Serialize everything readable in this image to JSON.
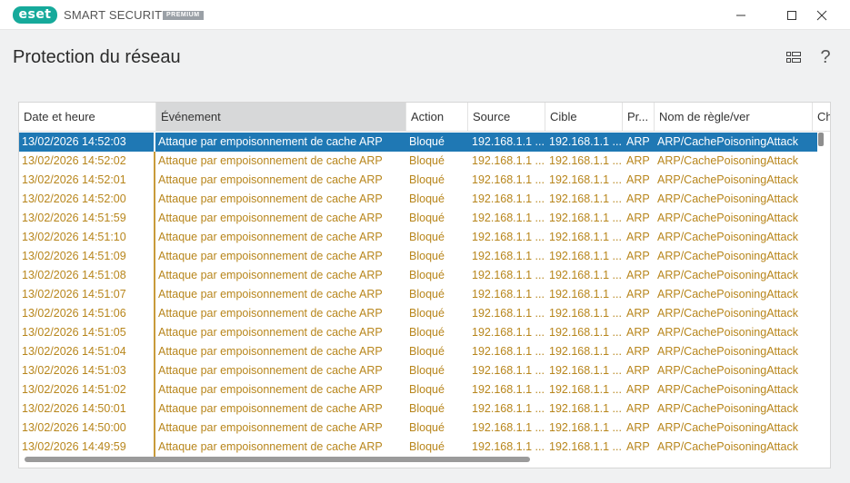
{
  "app": {
    "logo_text": "eset",
    "product_name": "SMART SECURITY",
    "edition": "PREMIUM"
  },
  "header": {
    "title": "Protection du réseau",
    "help_label": "?"
  },
  "table": {
    "columns": [
      "Date et heure",
      "Événement",
      "Action",
      "Source",
      "Cible",
      "Pr...",
      "Nom de règle/ver",
      "Ch"
    ],
    "sorted_column": "Événement",
    "rows": [
      {
        "date": "13/02/2026 14:52:03",
        "event": "Attaque par empoisonnement de cache ARP",
        "action": "Bloqué",
        "source": "192.168.1.1 ...",
        "target": "192.168.1.1 ...",
        "protocol": "ARP",
        "rule": "ARP/CachePoisoningAttack"
      },
      {
        "date": "13/02/2026 14:52:02",
        "event": "Attaque par empoisonnement de cache ARP",
        "action": "Bloqué",
        "source": "192.168.1.1 ...",
        "target": "192.168.1.1 ...",
        "protocol": "ARP",
        "rule": "ARP/CachePoisoningAttack"
      },
      {
        "date": "13/02/2026 14:52:01",
        "event": "Attaque par empoisonnement de cache ARP",
        "action": "Bloqué",
        "source": "192.168.1.1 ...",
        "target": "192.168.1.1 ...",
        "protocol": "ARP",
        "rule": "ARP/CachePoisoningAttack"
      },
      {
        "date": "13/02/2026 14:52:00",
        "event": "Attaque par empoisonnement de cache ARP",
        "action": "Bloqué",
        "source": "192.168.1.1 ...",
        "target": "192.168.1.1 ...",
        "protocol": "ARP",
        "rule": "ARP/CachePoisoningAttack"
      },
      {
        "date": "13/02/2026 14:51:59",
        "event": "Attaque par empoisonnement de cache ARP",
        "action": "Bloqué",
        "source": "192.168.1.1 ...",
        "target": "192.168.1.1 ...",
        "protocol": "ARP",
        "rule": "ARP/CachePoisoningAttack"
      },
      {
        "date": "13/02/2026 14:51:10",
        "event": "Attaque par empoisonnement de cache ARP",
        "action": "Bloqué",
        "source": "192.168.1.1 ...",
        "target": "192.168.1.1 ...",
        "protocol": "ARP",
        "rule": "ARP/CachePoisoningAttack"
      },
      {
        "date": "13/02/2026 14:51:09",
        "event": "Attaque par empoisonnement de cache ARP",
        "action": "Bloqué",
        "source": "192.168.1.1 ...",
        "target": "192.168.1.1 ...",
        "protocol": "ARP",
        "rule": "ARP/CachePoisoningAttack"
      },
      {
        "date": "13/02/2026 14:51:08",
        "event": "Attaque par empoisonnement de cache ARP",
        "action": "Bloqué",
        "source": "192.168.1.1 ...",
        "target": "192.168.1.1 ...",
        "protocol": "ARP",
        "rule": "ARP/CachePoisoningAttack"
      },
      {
        "date": "13/02/2026 14:51:07",
        "event": "Attaque par empoisonnement de cache ARP",
        "action": "Bloqué",
        "source": "192.168.1.1 ...",
        "target": "192.168.1.1 ...",
        "protocol": "ARP",
        "rule": "ARP/CachePoisoningAttack"
      },
      {
        "date": "13/02/2026 14:51:06",
        "event": "Attaque par empoisonnement de cache ARP",
        "action": "Bloqué",
        "source": "192.168.1.1 ...",
        "target": "192.168.1.1 ...",
        "protocol": "ARP",
        "rule": "ARP/CachePoisoningAttack"
      },
      {
        "date": "13/02/2026 14:51:05",
        "event": "Attaque par empoisonnement de cache ARP",
        "action": "Bloqué",
        "source": "192.168.1.1 ...",
        "target": "192.168.1.1 ...",
        "protocol": "ARP",
        "rule": "ARP/CachePoisoningAttack"
      },
      {
        "date": "13/02/2026 14:51:04",
        "event": "Attaque par empoisonnement de cache ARP",
        "action": "Bloqué",
        "source": "192.168.1.1 ...",
        "target": "192.168.1.1 ...",
        "protocol": "ARP",
        "rule": "ARP/CachePoisoningAttack"
      },
      {
        "date": "13/02/2026 14:51:03",
        "event": "Attaque par empoisonnement de cache ARP",
        "action": "Bloqué",
        "source": "192.168.1.1 ...",
        "target": "192.168.1.1 ...",
        "protocol": "ARP",
        "rule": "ARP/CachePoisoningAttack"
      },
      {
        "date": "13/02/2026 14:51:02",
        "event": "Attaque par empoisonnement de cache ARP",
        "action": "Bloqué",
        "source": "192.168.1.1 ...",
        "target": "192.168.1.1 ...",
        "protocol": "ARP",
        "rule": "ARP/CachePoisoningAttack"
      },
      {
        "date": "13/02/2026 14:50:01",
        "event": "Attaque par empoisonnement de cache ARP",
        "action": "Bloqué",
        "source": "192.168.1.1 ...",
        "target": "192.168.1.1 ...",
        "protocol": "ARP",
        "rule": "ARP/CachePoisoningAttack"
      },
      {
        "date": "13/02/2026 14:50:00",
        "event": "Attaque par empoisonnement de cache ARP",
        "action": "Bloqué",
        "source": "192.168.1.1 ...",
        "target": "192.168.1.1 ...",
        "protocol": "ARP",
        "rule": "ARP/CachePoisoningAttack"
      },
      {
        "date": "13/02/2026 14:49:59",
        "event": "Attaque par empoisonnement de cache ARP",
        "action": "Bloqué",
        "source": "192.168.1.1 ...",
        "target": "192.168.1.1 ...",
        "protocol": "ARP",
        "rule": "ARP/CachePoisoningAttack"
      }
    ],
    "selected_row_index": 0
  },
  "colors": {
    "accent_selected": "#1f78b4",
    "row_text": "#b8861c",
    "brand": "#16aa9b"
  },
  "icons": {
    "minimize": "minimize-icon",
    "maximize": "maximize-icon",
    "close": "close-icon",
    "view_toggle": "view-list-icon",
    "help": "help-icon"
  }
}
